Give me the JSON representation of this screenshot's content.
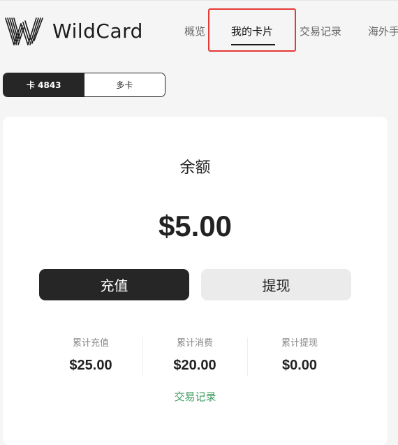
{
  "brand": {
    "name": "WildCard",
    "logo_icon": "wildcard-w-logo-icon"
  },
  "nav": {
    "items": [
      {
        "label": "概览"
      },
      {
        "label": "我的卡片",
        "active": true
      },
      {
        "label": "交易记录"
      },
      {
        "label": "海外手"
      }
    ]
  },
  "card_toggle": {
    "active_label": "卡 4843",
    "other_label": "多卡"
  },
  "balance": {
    "label": "余额",
    "amount": "$5.00"
  },
  "actions": {
    "topup_label": "充值",
    "withdraw_label": "提现"
  },
  "stats": [
    {
      "label": "累计充值",
      "value": "$25.00"
    },
    {
      "label": "累计消费",
      "value": "$20.00"
    },
    {
      "label": "累计提现",
      "value": "$0.00"
    }
  ],
  "transactions_link": "交易记录",
  "colors": {
    "background": "#f5f5f5",
    "dark": "#262626",
    "link_green": "#3a9a5c",
    "highlight_red": "#e53935"
  }
}
